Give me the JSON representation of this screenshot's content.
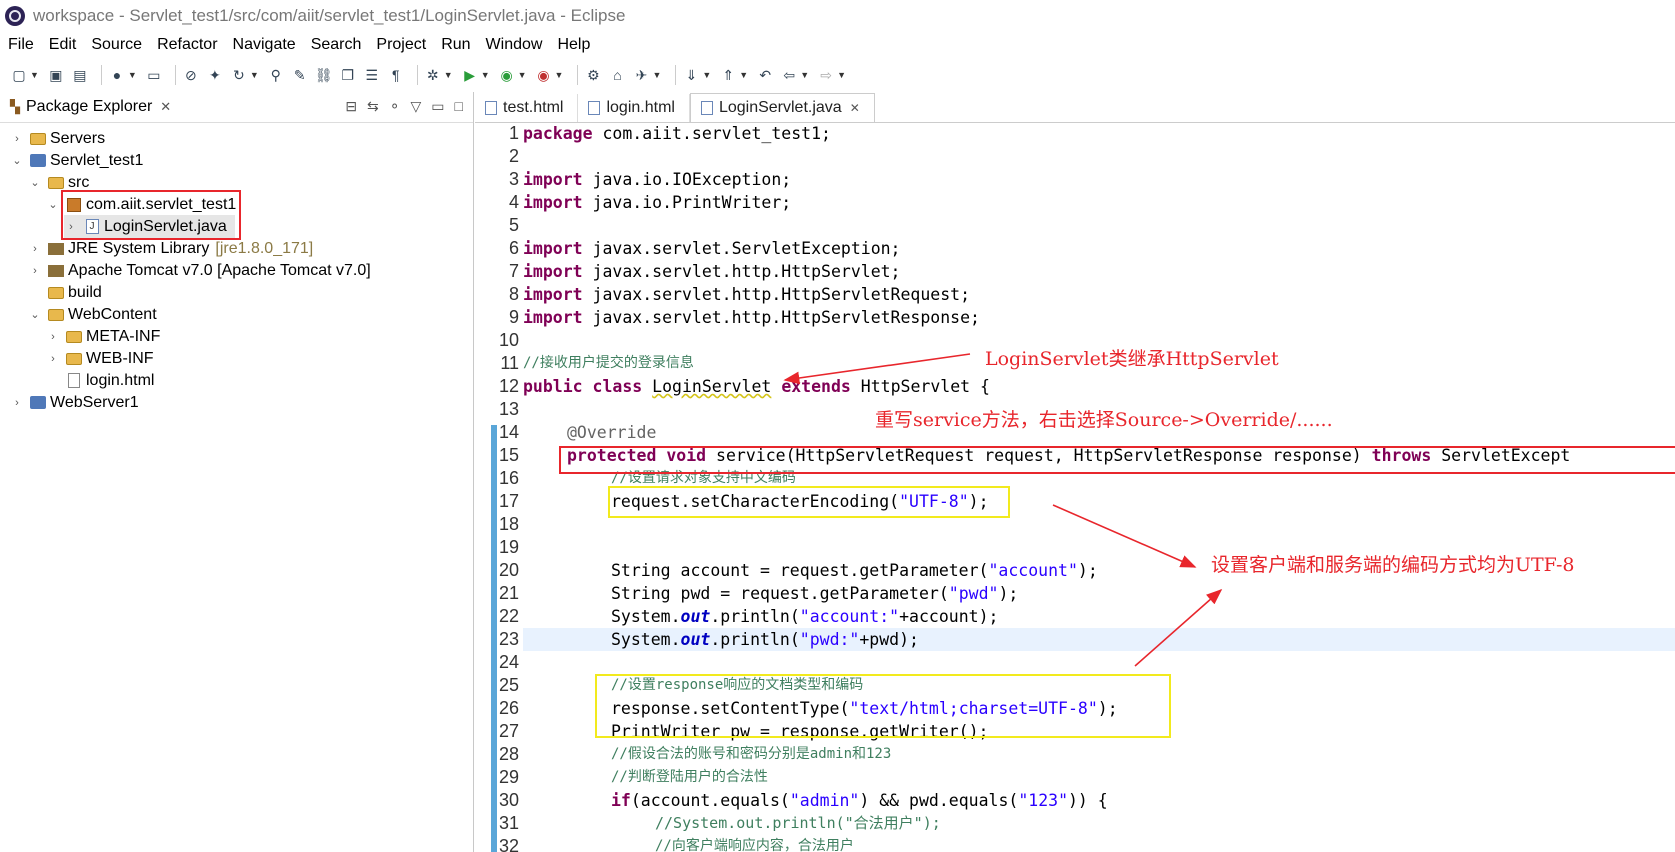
{
  "window": {
    "title": "workspace - Servlet_test1/src/com/aiit/servlet_test1/LoginServlet.java - Eclipse"
  },
  "menu": [
    "File",
    "Edit",
    "Source",
    "Refactor",
    "Navigate",
    "Search",
    "Project",
    "Run",
    "Window",
    "Help"
  ],
  "explorer": {
    "title": "Package Explorer",
    "close": "✕",
    "nodes": [
      {
        "label": "Servers",
        "suffix": ""
      },
      {
        "label": "Servlet_test1",
        "suffix": ""
      },
      {
        "label": "src",
        "suffix": ""
      },
      {
        "label": "com.aiit.servlet_test1",
        "suffix": ""
      },
      {
        "label": "LoginServlet.java",
        "suffix": ""
      },
      {
        "label": "JRE System Library",
        "suffix": "[jre1.8.0_171]"
      },
      {
        "label": "Apache Tomcat v7.0 [Apache Tomcat v7.0]",
        "suffix": ""
      },
      {
        "label": "build",
        "suffix": ""
      },
      {
        "label": "WebContent",
        "suffix": ""
      },
      {
        "label": "META-INF",
        "suffix": ""
      },
      {
        "label": "WEB-INF",
        "suffix": ""
      },
      {
        "label": "login.html",
        "suffix": ""
      },
      {
        "label": "WebServer1",
        "suffix": ""
      }
    ]
  },
  "tabs": [
    {
      "label": "test.html"
    },
    {
      "label": "login.html"
    },
    {
      "label": "LoginServlet.java",
      "close": "✕"
    }
  ],
  "code": {
    "l1_pkg": "package",
    "l1_rest": " com.aiit.servlet_test1;",
    "imp": "import",
    "l3": " java.io.IOException;",
    "l4": " java.io.PrintWriter;",
    "l6": " javax.servlet.ServletException;",
    "l7": " javax.servlet.http.HttpServlet;",
    "l8": " javax.servlet.http.HttpServletRequest;",
    "l9": " javax.servlet.http.HttpServletResponse;",
    "l11": "//接收用户提交的登录信息",
    "l12_public": "public",
    "l12_class": "class",
    "l12_name": "LoginServlet",
    "l12_extends": "extends",
    "l12_rest": " HttpServlet {",
    "l14": "@Override",
    "l15_protected": "protected",
    "l15_void": "void",
    "l15_mid": " service(HttpServletRequest request, HttpServletResponse response) ",
    "l15_throws": "throws",
    "l15_rest": " ServletExcept",
    "l16": "//设置请求对象支持中文编码",
    "l17_a": "request.setCharacterEncoding(",
    "l17_s": "\"UTF-8\"",
    "l17_b": ");",
    "l20_a": "String account = request.getParameter(",
    "l20_s": "\"account\"",
    "l20_b": ");",
    "l21_a": "String pwd = request.getParameter(",
    "l21_s": "\"pwd\"",
    "l21_b": ");",
    "l22_a": "System.",
    "out": "out",
    "l22_b": ".println(",
    "l22_s": "\"account:\"",
    "l22_c": "+account);",
    "l23_s": "\"pwd:\"",
    "l23_c": "+pwd);",
    "l25": "//设置response响应的文档类型和编码",
    "l26_a": "response.setContentType(",
    "l26_s": "\"text/html;charset=UTF-8\"",
    "l26_b": ");",
    "l27": "PrintWriter pw = response.getWriter();",
    "l28": "//假设合法的账号和密码分别是admin和123",
    "l29": "//判断登陆用户的合法性",
    "l30_if": "if",
    "l30_a": "(account.equals(",
    "l30_s1": "\"admin\"",
    "l30_b": ") && pwd.equals(",
    "l30_s2": "\"123\"",
    "l30_c": ")) {",
    "l31": "//System.out.println(\"合法用户\");",
    "l32": "//向客户端响应内容，合法用户"
  },
  "annotations": {
    "a1": "LoginServlet类继承HttpServlet",
    "a2": "重写service方法，右击选择Source->Override/......",
    "a3": "设置客户端和服务端的编码方式均为UTF-8"
  },
  "colors": {
    "highlight_red": "#e8262c",
    "highlight_yellow": "#f2ea1d",
    "keyword": "#7f0055",
    "string": "#2a00ff",
    "comment": "#3f7f5f"
  }
}
